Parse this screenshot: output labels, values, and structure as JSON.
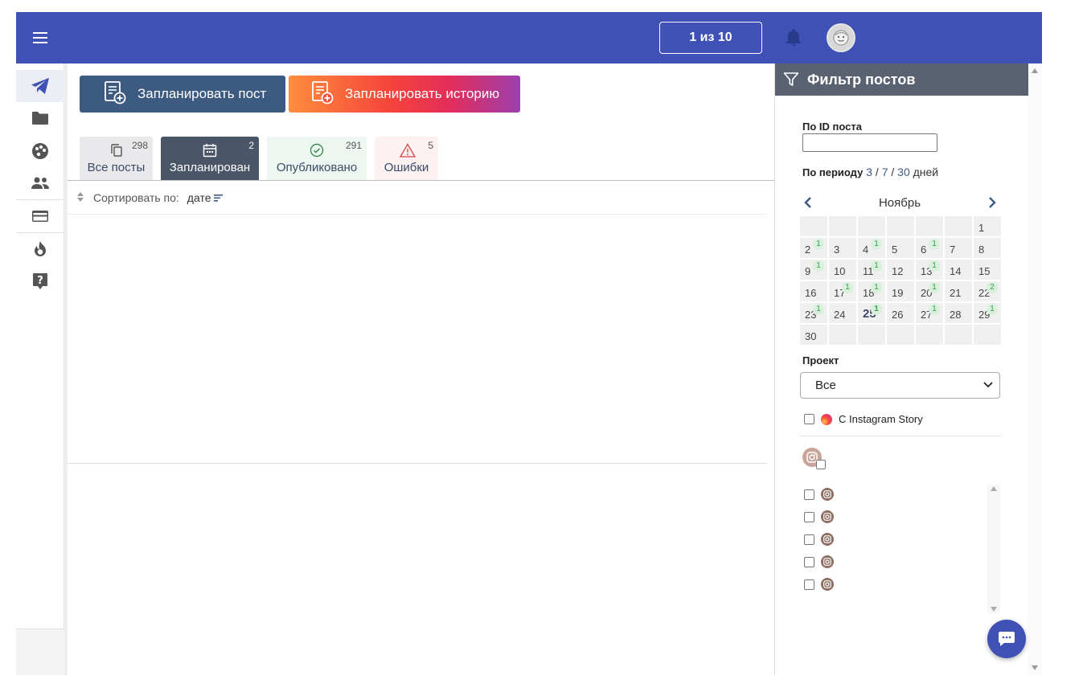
{
  "topbar": {
    "menu_icon": "hamburger-icon",
    "counter_label": "1 из 10",
    "bell_icon": "bell-icon",
    "avatar_icon": "avatar-icon"
  },
  "sidebar": {
    "items": [
      {
        "icon": "send-icon",
        "active": true
      },
      {
        "icon": "folder-icon"
      },
      {
        "icon": "palette-icon"
      },
      {
        "icon": "people-icon"
      },
      {
        "icon": "credit-card-icon"
      },
      {
        "icon": "fire-icon"
      },
      {
        "icon": "help-icon"
      }
    ]
  },
  "actions": {
    "schedule_post_label": "Запланировать пост",
    "schedule_story_label": "Запланировать историю"
  },
  "tabs": [
    {
      "label": "Все посты",
      "count": "298",
      "icon": "copy-icon"
    },
    {
      "label": "Запланирован",
      "count": "2",
      "icon": "calendar-icon"
    },
    {
      "label": "Опубликовано",
      "count": "291",
      "icon": "check-circle-icon"
    },
    {
      "label": "Ошибки",
      "count": "5",
      "icon": "warning-icon"
    }
  ],
  "sort": {
    "label": "Сортировать по:",
    "value": "дате"
  },
  "filter": {
    "title": "Фильтр постов",
    "post_id_label": "По ID поста",
    "post_id_value": "",
    "period_label": "По периоду",
    "period_options": [
      "3",
      "7",
      "30"
    ],
    "period_sep": "/",
    "period_unit": "дней",
    "month": "Ноябрь",
    "calendar": [
      [
        null,
        null,
        null,
        null,
        null,
        null,
        {
          "d": "1"
        }
      ],
      [
        {
          "d": "2",
          "n": "1"
        },
        {
          "d": "3"
        },
        {
          "d": "4",
          "n": "1"
        },
        {
          "d": "5"
        },
        {
          "d": "6",
          "n": "1"
        },
        {
          "d": "7"
        },
        {
          "d": "8"
        }
      ],
      [
        {
          "d": "9",
          "n": "1"
        },
        {
          "d": "10"
        },
        {
          "d": "11",
          "n": "1"
        },
        {
          "d": "12"
        },
        {
          "d": "13",
          "n": "1"
        },
        {
          "d": "14"
        },
        {
          "d": "15"
        }
      ],
      [
        {
          "d": "16"
        },
        {
          "d": "17",
          "n": "1"
        },
        {
          "d": "18",
          "n": "1"
        },
        {
          "d": "19"
        },
        {
          "d": "20",
          "n": "1"
        },
        {
          "d": "21"
        },
        {
          "d": "22",
          "n": "2"
        }
      ],
      [
        {
          "d": "23",
          "n": "1"
        },
        {
          "d": "24"
        },
        {
          "d": "25",
          "n": "1",
          "today": true
        },
        {
          "d": "26"
        },
        {
          "d": "27",
          "n": "1"
        },
        {
          "d": "28"
        },
        {
          "d": "29",
          "n": "1"
        }
      ],
      [
        {
          "d": "30"
        },
        null,
        null,
        null,
        null,
        null,
        null
      ]
    ],
    "project_label": "Проект",
    "project_value": "Все",
    "story_checkbox_label": "С Instagram Story",
    "account_count": 5
  },
  "colors": {
    "primary": "#3f51b5",
    "post_button": "#3d5a80",
    "active_tab": "#4a5568",
    "filter_header": "#5a6170",
    "badge_green": "#39a050"
  }
}
